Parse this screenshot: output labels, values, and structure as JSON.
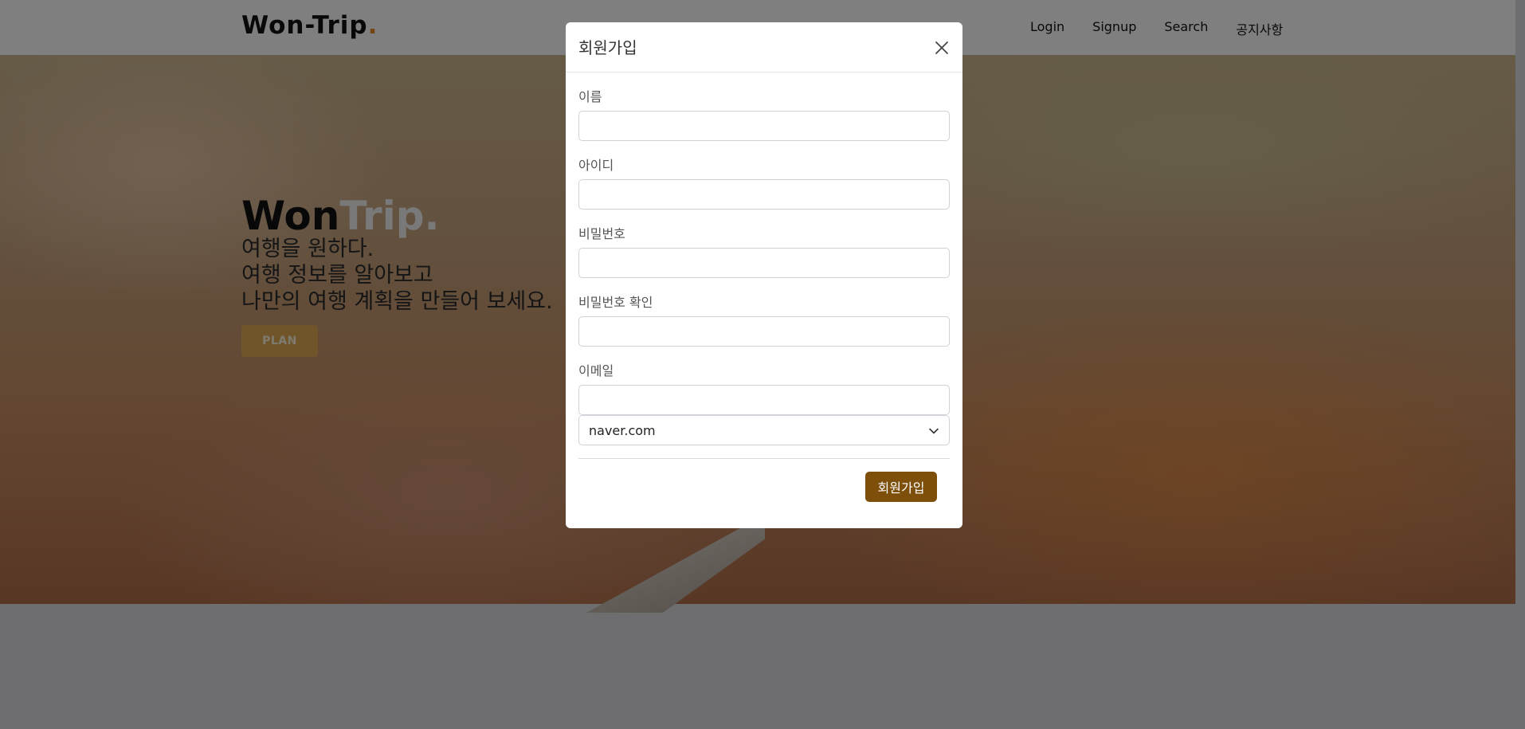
{
  "navbar": {
    "brand_text": "Won-Trip",
    "brand_dot": ".",
    "links": [
      "Login",
      "Signup",
      "Search",
      "공지사항"
    ]
  },
  "hero": {
    "title_won": "Won",
    "title_trip": "Trip.",
    "subtitle_lines": [
      "여행을 원하다.",
      "여행 정보를 알아보고",
      "나만의 여행 계획을 만들어 보세요."
    ],
    "plan_label": "PLAN"
  },
  "modal": {
    "title": "회원가입",
    "fields": [
      {
        "label": "이름",
        "value": "",
        "placeholder": ""
      },
      {
        "label": "아이디",
        "value": "",
        "placeholder": ""
      },
      {
        "label": "비밀번호",
        "value": "",
        "placeholder": ""
      },
      {
        "label": "비밀번호 확인",
        "value": "",
        "placeholder": ""
      },
      {
        "label": "이메일",
        "value": "",
        "placeholder": ""
      }
    ],
    "email_domain": "naver.com",
    "submit_label": "회원가입"
  },
  "colors": {
    "accent": "#7d4f0b",
    "brand_dot": "#e88a27",
    "plan_button": "#e0aa55"
  },
  "icons": {
    "close": "close-icon",
    "select": "chevron-down-icon"
  }
}
